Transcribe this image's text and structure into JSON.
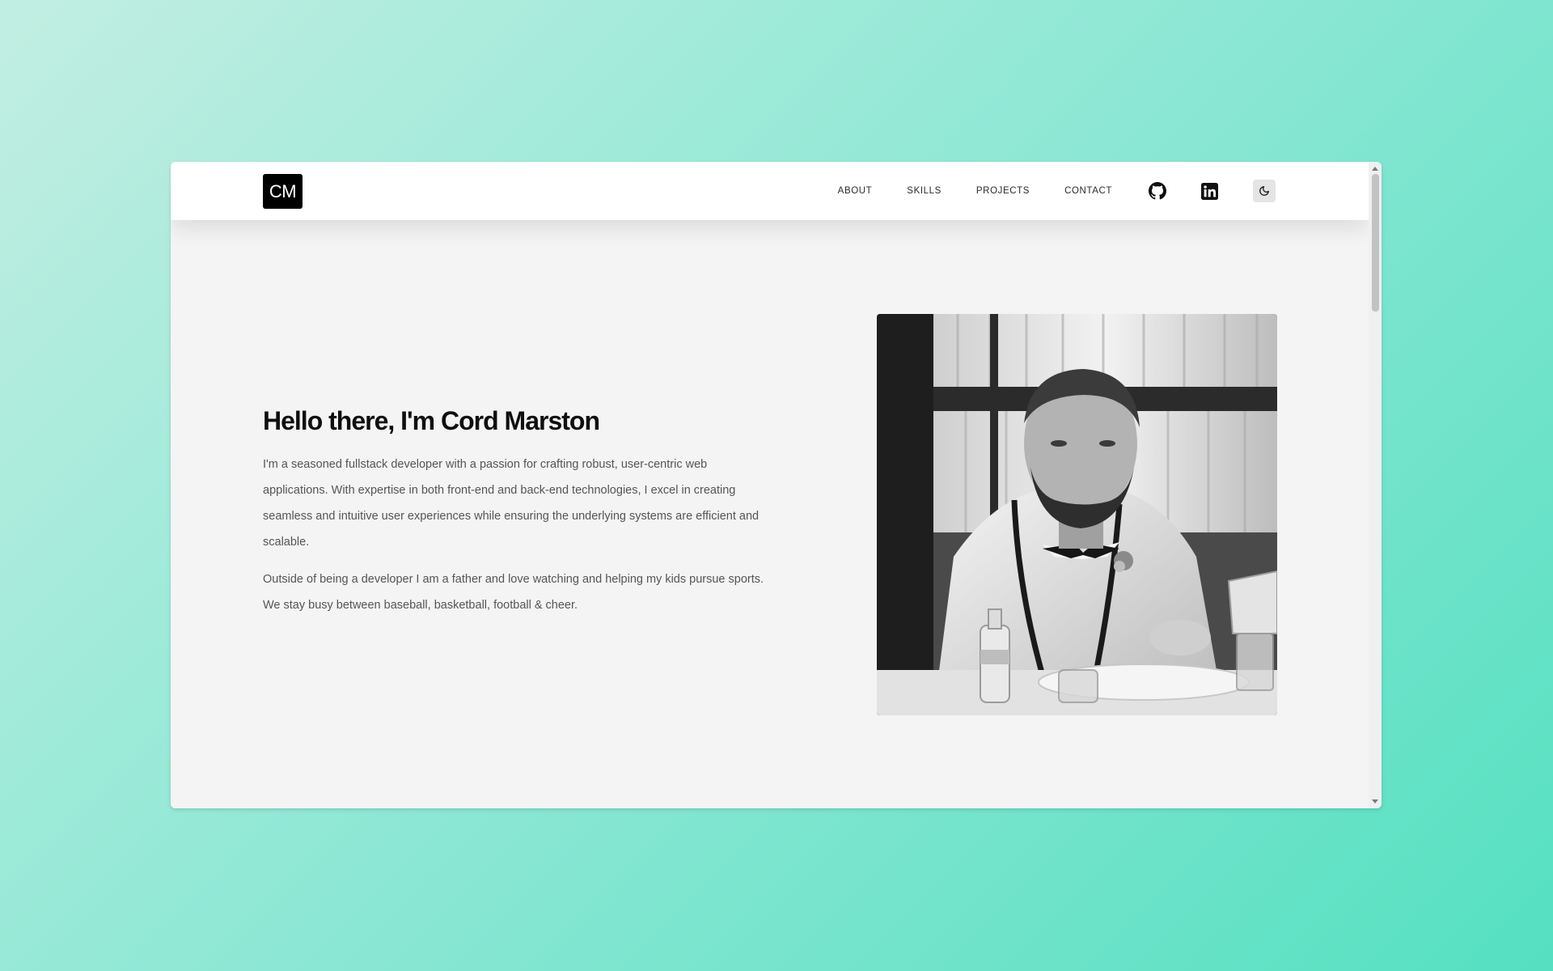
{
  "logo": {
    "text": "CM"
  },
  "nav": {
    "links": [
      {
        "label": "ABOUT"
      },
      {
        "label": "SKILLS"
      },
      {
        "label": "PROJECTS"
      },
      {
        "label": "CONTACT"
      }
    ],
    "icons": [
      "github-icon",
      "linkedin-icon",
      "moon-icon"
    ]
  },
  "hero": {
    "title": "Hello there, I'm Cord Marston",
    "paragraphs": [
      "I'm a seasoned fullstack developer with a passion for crafting robust, user-centric web applications. With expertise in both front-end and back-end technologies, I excel in creating seamless and intuitive user experiences while ensuring the underlying systems are efficient and scalable.",
      "Outside of being a developer I am a father and love watching and helping my kids pursue sports. We stay busy between baseball, basketball, football & cheer."
    ]
  },
  "colors": {
    "background_gradient_start": "#c2eee2",
    "background_gradient_end": "#55e0c1",
    "page_background": "#f4f4f4",
    "navbar_background": "#ffffff",
    "logo_background": "#000000",
    "heading_color": "#0f0f0f",
    "body_text_color": "#555555"
  }
}
